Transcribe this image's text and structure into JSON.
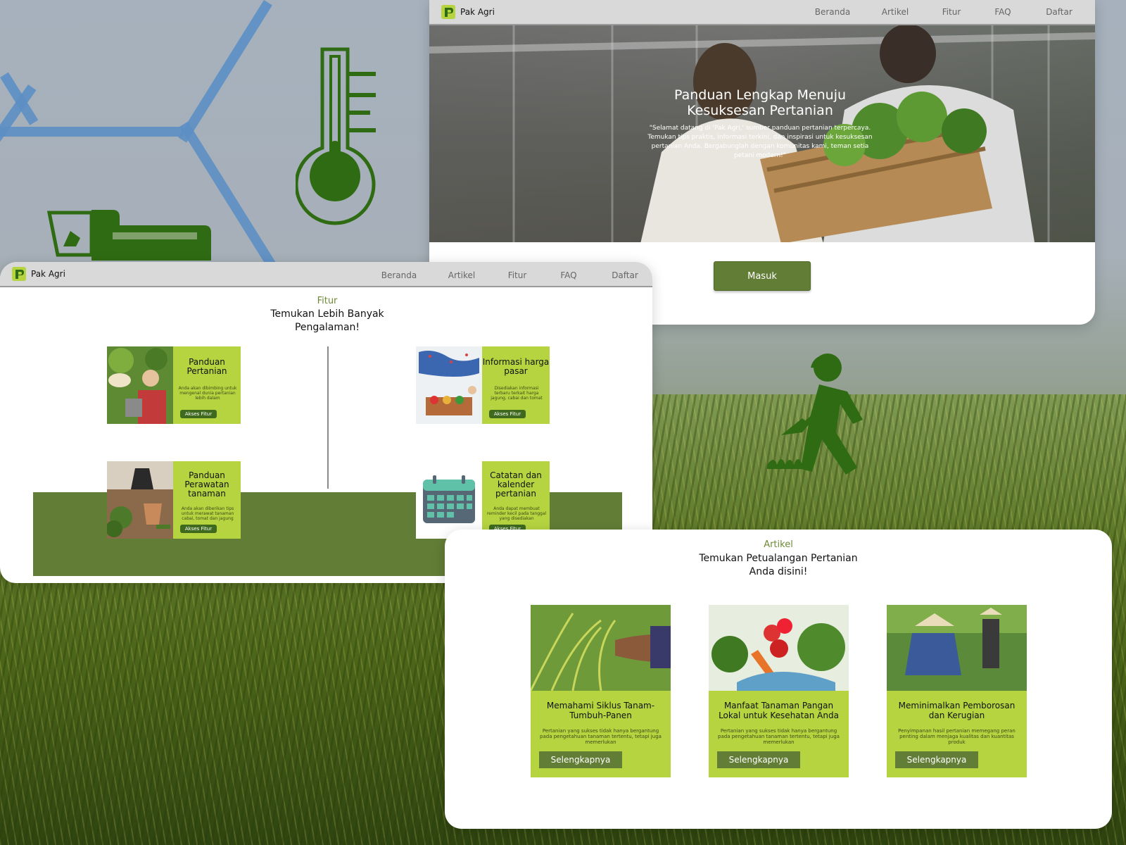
{
  "colors": {
    "brand_green": "#627d36",
    "lime": "#b5d440",
    "dark_green": "#2f6b12",
    "hex_blue": "#5c8fc4",
    "navbar": "#d9d9d9"
  },
  "brand": {
    "name": "Pak Agri",
    "icon": "pak-agri-logo"
  },
  "nav": {
    "items": [
      "Beranda",
      "Artikel",
      "Fitur",
      "FAQ",
      "Daftar"
    ]
  },
  "hero": {
    "title": "Panduan Lengkap Menuju Kesuksesan Pertanian",
    "description": "\"Selamat datang di 'Pak Agri,' sumber panduan pertanian terpercaya. Temukan tips praktis, informasi terkini, dan inspirasi untuk kesuksesan pertanian Anda. Bergabunglah dengan komunitas kami, teman setia petani modern!\"",
    "login_label": "Masuk"
  },
  "fitur": {
    "label": "Fitur",
    "title": "Temukan Lebih Banyak Pengalaman!",
    "cards": [
      {
        "title": "Panduan Pertanian",
        "description": "Anda akan dibimbing untuk mengenal dunia pertanian lebih dalam",
        "action": "Akses Fitur"
      },
      {
        "title": "Informasi harga pasar",
        "description": "Disediakan informasi terbaru terkait harga jagung, cabai dan tomat",
        "action": "Akses Fitur"
      },
      {
        "title": "Panduan Perawatan tanaman",
        "description": "Anda akan diberikan tips untuk merawat tanaman cabai, tomat dan jagung",
        "action": "Akses Fitur"
      },
      {
        "title": "Catatan dan kalender pertanian",
        "description": "Anda dapat membuat reminder kecil pada tanggal yang disediakan",
        "action": "Akses Fitur"
      }
    ]
  },
  "artikel": {
    "label": "Artikel",
    "title": "Temukan Petualangan Pertanian Anda disini!",
    "cards": [
      {
        "title": "Memahami Siklus Tanam-Tumbuh-Panen",
        "description": "Pertanian yang sukses tidak hanya bergantung pada pengetahuan tanaman tertentu, tetapi juga memerlukan",
        "action": "Selengkapnya"
      },
      {
        "title": "Manfaat Tanaman Pangan Lokal untuk Kesehatan Anda",
        "description": "Pertanian yang sukses tidak hanya bergantung pada pengetahuan tanaman tertentu, tetapi juga memerlukan",
        "action": "Selengkapnya"
      },
      {
        "title": "Meminimalkan Pemborosan dan Kerugian",
        "description": "Penyimpanan hasil pertanian memegang peran penting dalam menjaga kualitas dan kuantitas produk",
        "action": "Selengkapnya"
      }
    ]
  }
}
